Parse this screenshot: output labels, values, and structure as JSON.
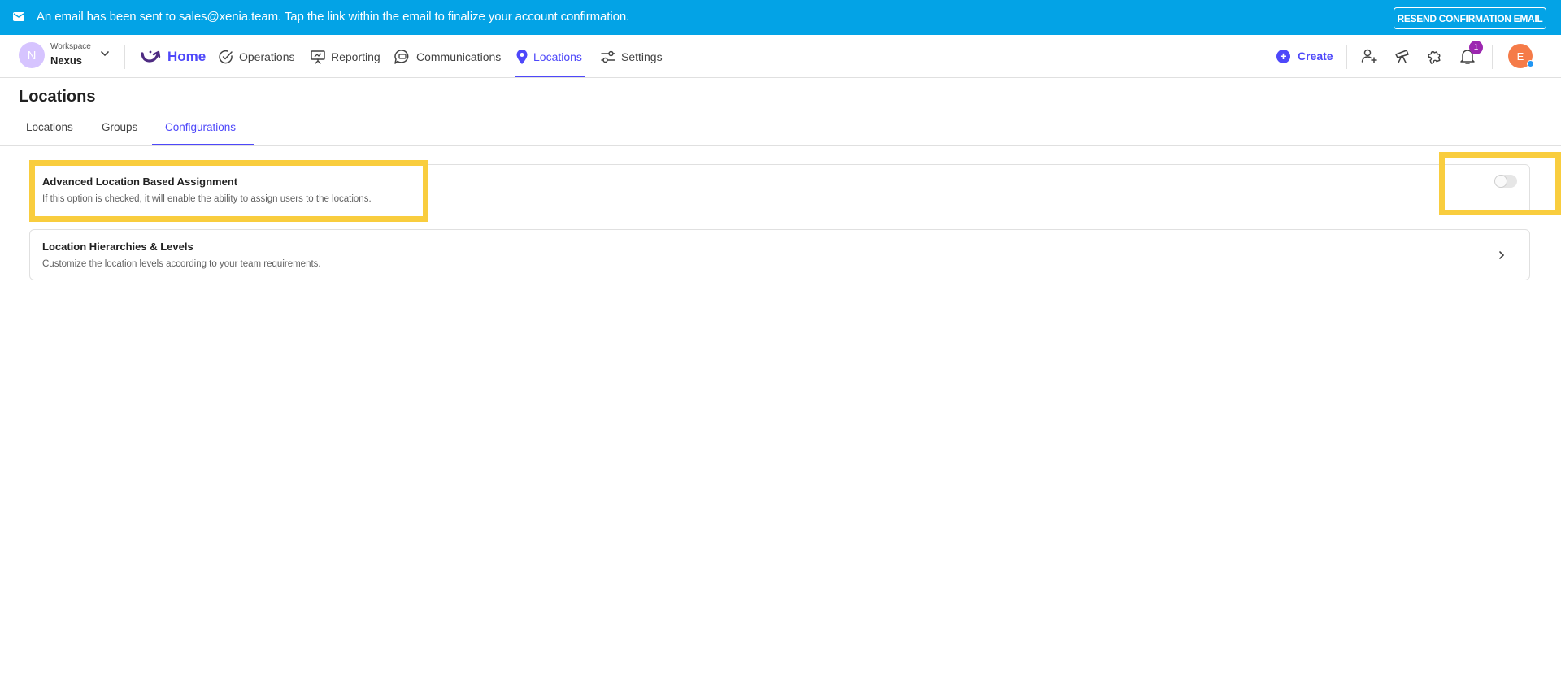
{
  "banner": {
    "message": "An email has been sent to sales@xenia.team. Tap the link within the email to finalize your account confirmation.",
    "resend_label": "RESEND CONFIRMATION EMAIL"
  },
  "workspace": {
    "avatar_letter": "N",
    "label": "Workspace",
    "name": "Nexus"
  },
  "nav": {
    "home": "Home",
    "operations": "Operations",
    "reporting": "Reporting",
    "communications": "Communications",
    "locations": "Locations",
    "settings": "Settings",
    "create": "Create",
    "notification_count": "1",
    "user_initial": "E"
  },
  "page": {
    "title": "Locations",
    "tabs": [
      "Locations",
      "Groups",
      "Configurations"
    ],
    "active_tab": "Configurations"
  },
  "config": {
    "advanced": {
      "title": "Advanced Location Based Assignment",
      "description": "If this option is checked, it will enable the ability to assign users to the locations.",
      "enabled": false
    },
    "hierarchies": {
      "title": "Location Hierarchies & Levels",
      "description": "Customize the location levels according to your team requirements."
    }
  },
  "colors": {
    "banner": "#03a3e6",
    "accent": "#4e48fa",
    "highlight": "#f9cd3e",
    "badge": "#9c27b0",
    "user_avatar": "#f57b48"
  }
}
